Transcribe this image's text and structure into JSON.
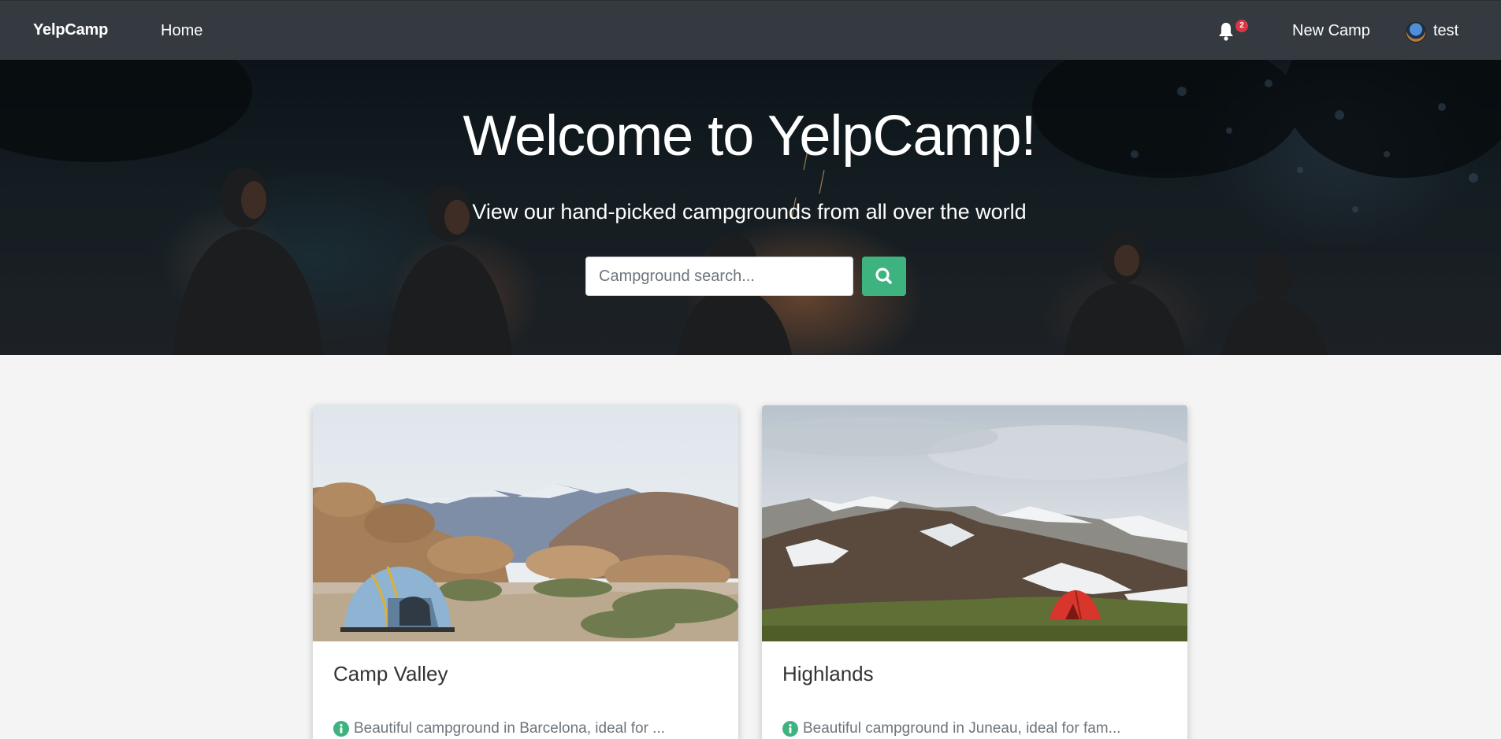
{
  "navbar": {
    "brand": "YelpCamp",
    "home_label": "Home",
    "notification_count": "2",
    "new_camp_label": "New Camp",
    "user_name": "test"
  },
  "hero": {
    "title": "Welcome to YelpCamp!",
    "subtitle": "View our hand-picked campgrounds from all over the world",
    "search_placeholder": "Campground search..."
  },
  "campgrounds": [
    {
      "name": "Camp Valley",
      "description": "Beautiful campground in Barcelona, ideal for ..."
    },
    {
      "name": "Highlands",
      "description": "Beautiful campground in Juneau, ideal for fam..."
    }
  ],
  "colors": {
    "navbar_bg": "#343a40",
    "accent_green": "#3fb37f",
    "badge_red": "#dc3545",
    "page_bg": "#f4f4f4"
  },
  "icons": [
    "bell-icon",
    "search-icon",
    "info-icon"
  ]
}
